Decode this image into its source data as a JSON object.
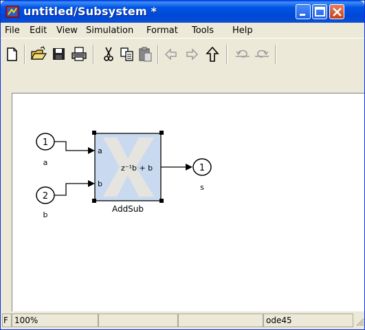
{
  "window": {
    "title": "untitled/Subsystem *"
  },
  "menu": [
    "File",
    "Edit",
    "View",
    "Simulation",
    "Format",
    "Tools",
    "Help"
  ],
  "toolbar": {
    "icons": [
      "new-icon",
      "open-icon",
      "save-icon",
      "print-icon",
      "cut-icon",
      "copy-icon",
      "paste-icon",
      "back-icon",
      "forward-icon",
      "up-icon",
      "undo-icon",
      "redo-icon"
    ]
  },
  "diagram": {
    "inport_a": {
      "number": "1",
      "label": "a"
    },
    "inport_b": {
      "number": "2",
      "label": "b"
    },
    "block": {
      "name": "AddSub",
      "port_a": "a",
      "port_b": "b",
      "expression": "z⁻¹b + b"
    },
    "outport": {
      "number": "1",
      "label": "s"
    }
  },
  "status": {
    "zoom": "100%",
    "solver": "ode45",
    "left_char": "F"
  }
}
